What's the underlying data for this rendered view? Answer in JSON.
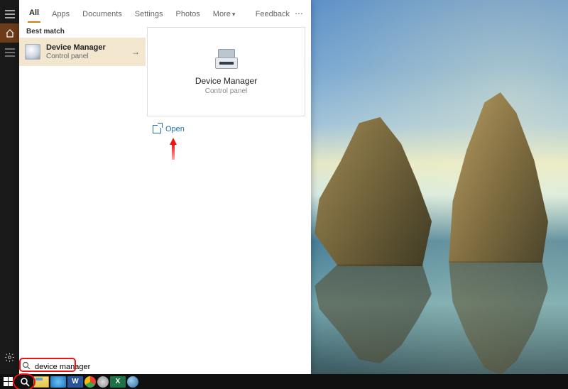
{
  "tabs": {
    "all": "All",
    "apps": "Apps",
    "documents": "Documents",
    "settings": "Settings",
    "photos": "Photos",
    "more": "More"
  },
  "header": {
    "feedback": "Feedback"
  },
  "results": {
    "section": "Best match",
    "item": {
      "title": "Device Manager",
      "subtitle": "Control panel"
    }
  },
  "detail": {
    "title": "Device Manager",
    "subtitle": "Control panel"
  },
  "actions": {
    "open": "Open"
  },
  "search": {
    "value": "device manager"
  },
  "taskbar": {
    "word_glyph": "W",
    "excel_glyph": "X"
  }
}
